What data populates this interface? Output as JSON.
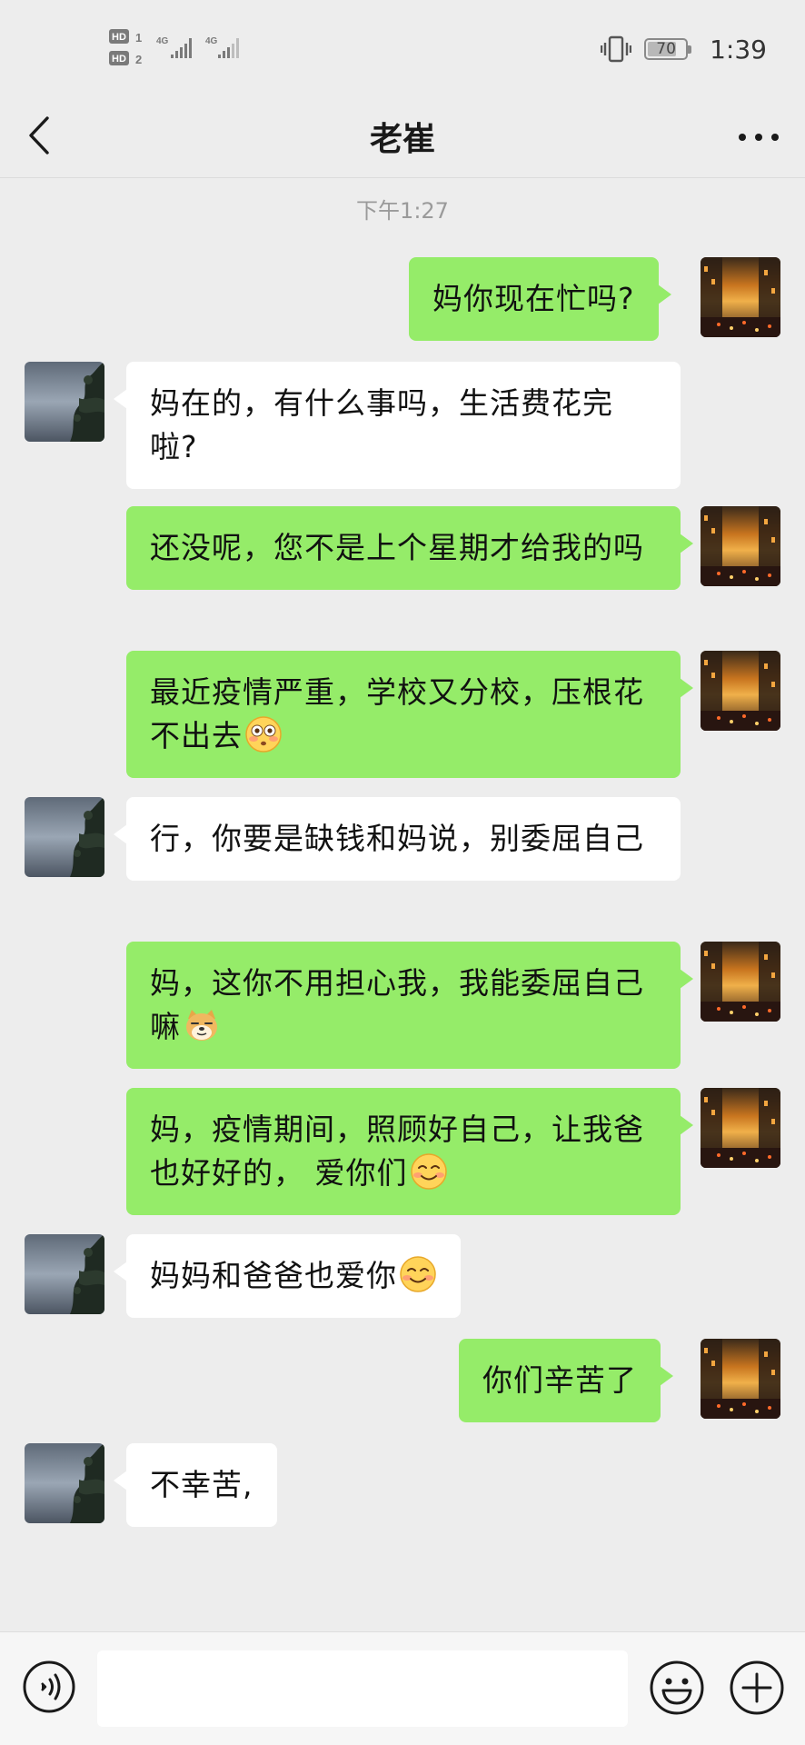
{
  "status_bar": {
    "sim1_badge": "HD",
    "sim1_index": "1",
    "sim2_badge": "HD",
    "sim2_index": "2",
    "network1": "4G",
    "network2": "4G",
    "battery_level": "70",
    "time": "1:39"
  },
  "header": {
    "title": "老崔",
    "back_icon": "chevron-left-icon",
    "more_icon": "more-dots-icon"
  },
  "chat": {
    "timestamp": "下午1:27",
    "messages": [
      {
        "sender": "me",
        "text": "妈你现在忙吗?"
      },
      {
        "sender": "them",
        "text": "妈在的，有什么事吗，生活费花完啦?"
      },
      {
        "sender": "me",
        "text": "还没呢，您不是上个星期才给我的吗"
      },
      {
        "sender": "me",
        "text": "最近疫情严重，学校又分校，压根花不出去",
        "emoji": "flushed-face-emoji"
      },
      {
        "sender": "them",
        "text": "行，你要是缺钱和妈说，别委屈自己"
      },
      {
        "sender": "me",
        "text": "妈，这你不用担心我，我能委屈自己嘛",
        "emoji": "doge-emoji"
      },
      {
        "sender": "me",
        "text": "妈，疫情期间，照顾好自己，让我爸也好好的， 爱你们",
        "emoji": "smiling-face-emoji"
      },
      {
        "sender": "them",
        "text": "妈妈和爸爸也爱你",
        "emoji": "smiling-face-emoji"
      },
      {
        "sender": "me",
        "text": "你们辛苦了"
      },
      {
        "sender": "them",
        "text": "不幸苦,"
      }
    ]
  },
  "input_bar": {
    "voice_icon": "voice-icon",
    "input_value": "",
    "emoji_icon": "emoji-icon",
    "plus_icon": "plus-icon"
  },
  "colors": {
    "background": "#ededed",
    "my_bubble": "#95ec69",
    "their_bubble": "#ffffff",
    "input_bar": "#f6f6f6"
  }
}
